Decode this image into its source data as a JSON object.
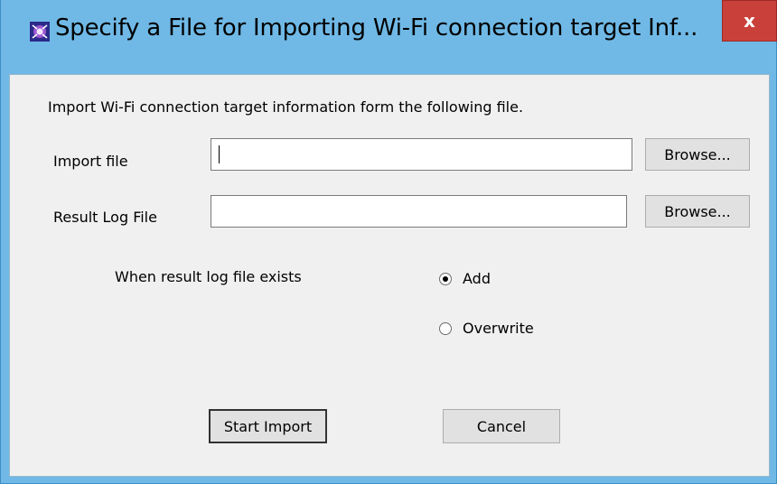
{
  "window": {
    "title": "Specify a File for Importing Wi-Fi connection target Inf...",
    "close_label": "x",
    "app_icon": "app-icon",
    "accent_color": "#70b9e6",
    "close_color": "#c9403a"
  },
  "form": {
    "instruction": "Import Wi-Fi connection target information form the following file.",
    "import_file": {
      "label": "Import file",
      "value": "",
      "browse_label": "Browse..."
    },
    "result_log": {
      "label": "Result Log File",
      "value": "",
      "browse_label": "Browse..."
    },
    "exists_option": {
      "label": "When result log file exists",
      "options": [
        {
          "label": "Add",
          "checked": true
        },
        {
          "label": "Overwrite",
          "checked": false
        }
      ]
    }
  },
  "buttons": {
    "start_import": "Start Import",
    "cancel": "Cancel"
  }
}
